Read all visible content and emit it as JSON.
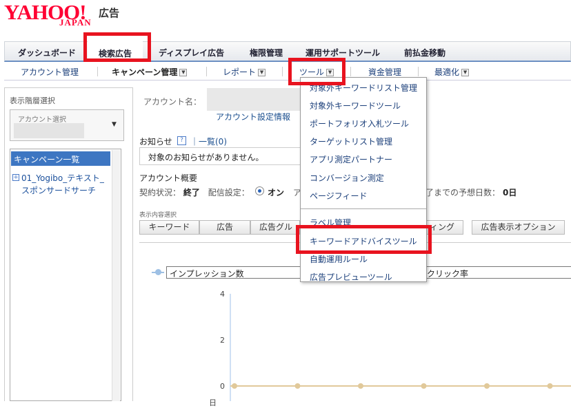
{
  "logo": {
    "brand": "YAHOO!",
    "sub": "JAPAN",
    "suffix": "広告"
  },
  "main_nav": [
    "ダッシュボード",
    "検索広告",
    "ディスプレイ広告",
    "権限管理",
    "運用サポートツール",
    "前払金移動"
  ],
  "sub_nav": [
    "アカウント管理",
    "キャンペーン管理",
    "レポート",
    "ツール",
    "資金管理",
    "最適化"
  ],
  "left": {
    "title": "表示階層選択",
    "account_select_label": "アカウント選択",
    "campaign_header": "キャンペーン一覧",
    "campaign_item": "01_Yogibo_テキスト_スポンサードサーチ"
  },
  "content": {
    "account_name_label": "アカウント名：",
    "account_settings_link": "アカウント設定情報",
    "notice_label": "お知らせ",
    "help": "?",
    "list_link": "｜一覧(0)",
    "notice_text": "対象のお知らせがありません。",
    "overview_label": "アカウント概要",
    "contract_label": "契約状況：",
    "contract_value": "終了",
    "delivery_label": "配信設定：",
    "delivery_value": "オン",
    "trail_text": "ア",
    "predict_label": "了までの予想日数：",
    "predict_value": "0日",
    "display_select_label": "表示内容選択",
    "display_buttons": [
      "キーワード",
      "広告",
      "広告グル",
      "ィング",
      "広告表示オプション"
    ],
    "metric1": "インプレッション数",
    "metric2": "クリック率",
    "date_label": "日"
  },
  "tools_menu": [
    "対象外キーワードリスト管理",
    "対象外キーワードツール",
    "ポートフォリオ入札ツール",
    "ターゲットリスト管理",
    "アプリ測定パートナー",
    "コンバージョン測定",
    "ページフィード",
    "ラベル管理",
    "キーワードアドバイスツール",
    "自動運用ルール",
    "広告プレビューツール"
  ],
  "chart_data": {
    "type": "line",
    "yticks": [
      "4",
      "2",
      "0"
    ],
    "ylim": [
      0,
      4
    ],
    "series": [
      {
        "values": [
          0,
          0,
          0,
          0,
          0,
          0
        ]
      }
    ]
  }
}
